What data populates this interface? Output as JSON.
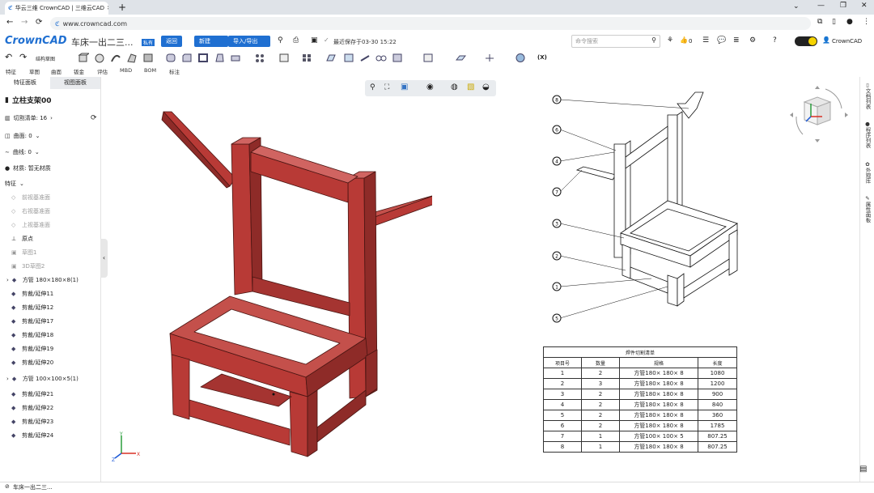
{
  "browser": {
    "tab_title": "华云三维 CrownCAD | 三维云CAD",
    "url": "www.crowncad.com"
  },
  "app": {
    "logo": "CrownCAD",
    "doc_title": "车床一出二三...",
    "badge": "私有",
    "back_label": "返回",
    "new_label": "新建",
    "import_export_label": "导入/导出",
    "autosave_text": "最近保存于03-30 15:22",
    "search_placeholder": "命令搜索",
    "like_count": "0",
    "user_name": "CrownCAD",
    "view_mode_label": "结构草图"
  },
  "menus": [
    "特征",
    "草图",
    "曲面",
    "钣金",
    "评估",
    "MBD",
    "BOM",
    "标注"
  ],
  "panel": {
    "tabs": [
      "特征面板",
      "视图面板"
    ],
    "part_name": "立柱支架00",
    "cut_list": "切割清单: 16",
    "surfaces": "曲面: 0",
    "curves": "曲线: 0",
    "material": "材质: 暂无材质",
    "features_label": "特征",
    "tree": [
      "前视基准面",
      "右视基准面",
      "上视基准面",
      "原点",
      "草图1",
      "3D草图2",
      "方管 180×180×8(1)",
      "剪裁/延伸11",
      "剪裁/延伸12",
      "剪裁/延伸17",
      "剪裁/延伸18",
      "剪裁/延伸19",
      "剪裁/延伸20",
      "方管 100×100×5(1)",
      "剪裁/延伸21",
      "剪裁/延伸22",
      "剪裁/延伸23",
      "剪裁/延伸24"
    ]
  },
  "right_strip": [
    "文档列表",
    "程序列表",
    "外观库",
    "属性面板"
  ],
  "status_bar": {
    "doc_tab": "车床一出二三..."
  },
  "bom_table": {
    "title": "焊件切割清单",
    "headers": [
      "项目号",
      "数量",
      "规格",
      "长度"
    ],
    "rows": [
      [
        "1",
        "2",
        "方管180× 180× 8",
        "1080"
      ],
      [
        "2",
        "3",
        "方管180× 180× 8",
        "1200"
      ],
      [
        "3",
        "2",
        "方管180× 180× 8",
        "900"
      ],
      [
        "4",
        "2",
        "方管180× 180× 8",
        "840"
      ],
      [
        "5",
        "2",
        "方管180× 180× 8",
        "360"
      ],
      [
        "6",
        "2",
        "方管180× 180× 8",
        "1785"
      ],
      [
        "7",
        "1",
        "方管100× 100× 5",
        "807.25"
      ],
      [
        "8",
        "1",
        "方管180× 180× 8",
        "807.25"
      ]
    ]
  },
  "balloons": [
    "8",
    "6",
    "4",
    "7",
    "3",
    "2",
    "1",
    "5"
  ],
  "colors": {
    "accent": "#1f6fd1",
    "model": "#b83a36"
  }
}
